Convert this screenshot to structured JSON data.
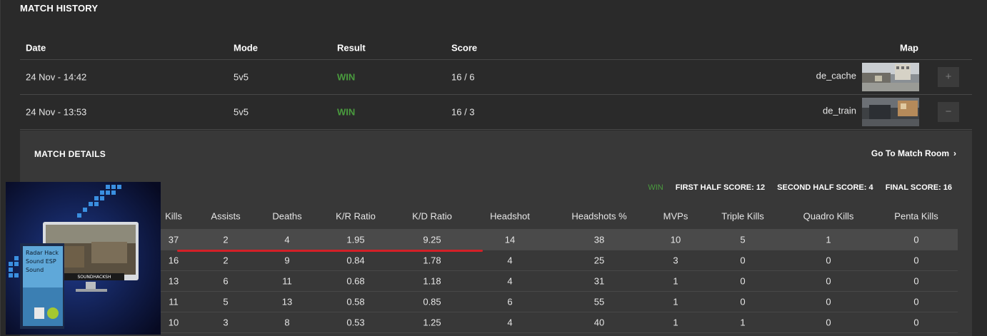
{
  "history": {
    "title": "MATCH HISTORY",
    "columns": {
      "date": "Date",
      "mode": "Mode",
      "result": "Result",
      "score": "Score",
      "map": "Map"
    },
    "rows": [
      {
        "date": "24 Nov - 14:42",
        "mode": "5v5",
        "result": "WIN",
        "score": "16 / 6",
        "map": "de_cache",
        "toggle": "+"
      },
      {
        "date": "24 Nov - 13:53",
        "mode": "5v5",
        "result": "WIN",
        "score": "16 / 3",
        "map": "de_train",
        "toggle": "−"
      }
    ]
  },
  "details": {
    "title": "MATCH DETAILS",
    "match_room": "Go To Match Room",
    "summary": {
      "result": "WIN",
      "first_half": "FIRST HALF SCORE: 12",
      "second_half": "SECOND HALF SCORE: 4",
      "final": "FINAL SCORE: 16"
    },
    "columns": [
      "Kills",
      "Assists",
      "Deaths",
      "K/R Ratio",
      "K/D Ratio",
      "Headshot",
      "Headshots %",
      "MVPs",
      "Triple Kills",
      "Quadro Kills",
      "Penta Kills"
    ],
    "rows": [
      [
        "37",
        "2",
        "4",
        "1.95",
        "9.25",
        "14",
        "38",
        "10",
        "5",
        "1",
        "0"
      ],
      [
        "16",
        "2",
        "9",
        "0.84",
        "1.78",
        "4",
        "25",
        "3",
        "0",
        "0",
        "0"
      ],
      [
        "13",
        "6",
        "11",
        "0.68",
        "1.18",
        "4",
        "31",
        "1",
        "0",
        "0",
        "0"
      ],
      [
        "11",
        "5",
        "13",
        "0.58",
        "0.85",
        "6",
        "55",
        "1",
        "0",
        "0",
        "0"
      ],
      [
        "10",
        "3",
        "8",
        "0.53",
        "1.25",
        "4",
        "40",
        "1",
        "1",
        "0",
        "0"
      ]
    ]
  },
  "promo": {
    "lines": [
      "Radar Hack",
      "Sound ESP",
      "Sound"
    ],
    "monitor_label": "SOUNDHACKSH"
  },
  "colors": {
    "win": "#4a9c3e",
    "highlight": "#d42027",
    "panel": "#383838",
    "background": "#2a2a2a"
  }
}
